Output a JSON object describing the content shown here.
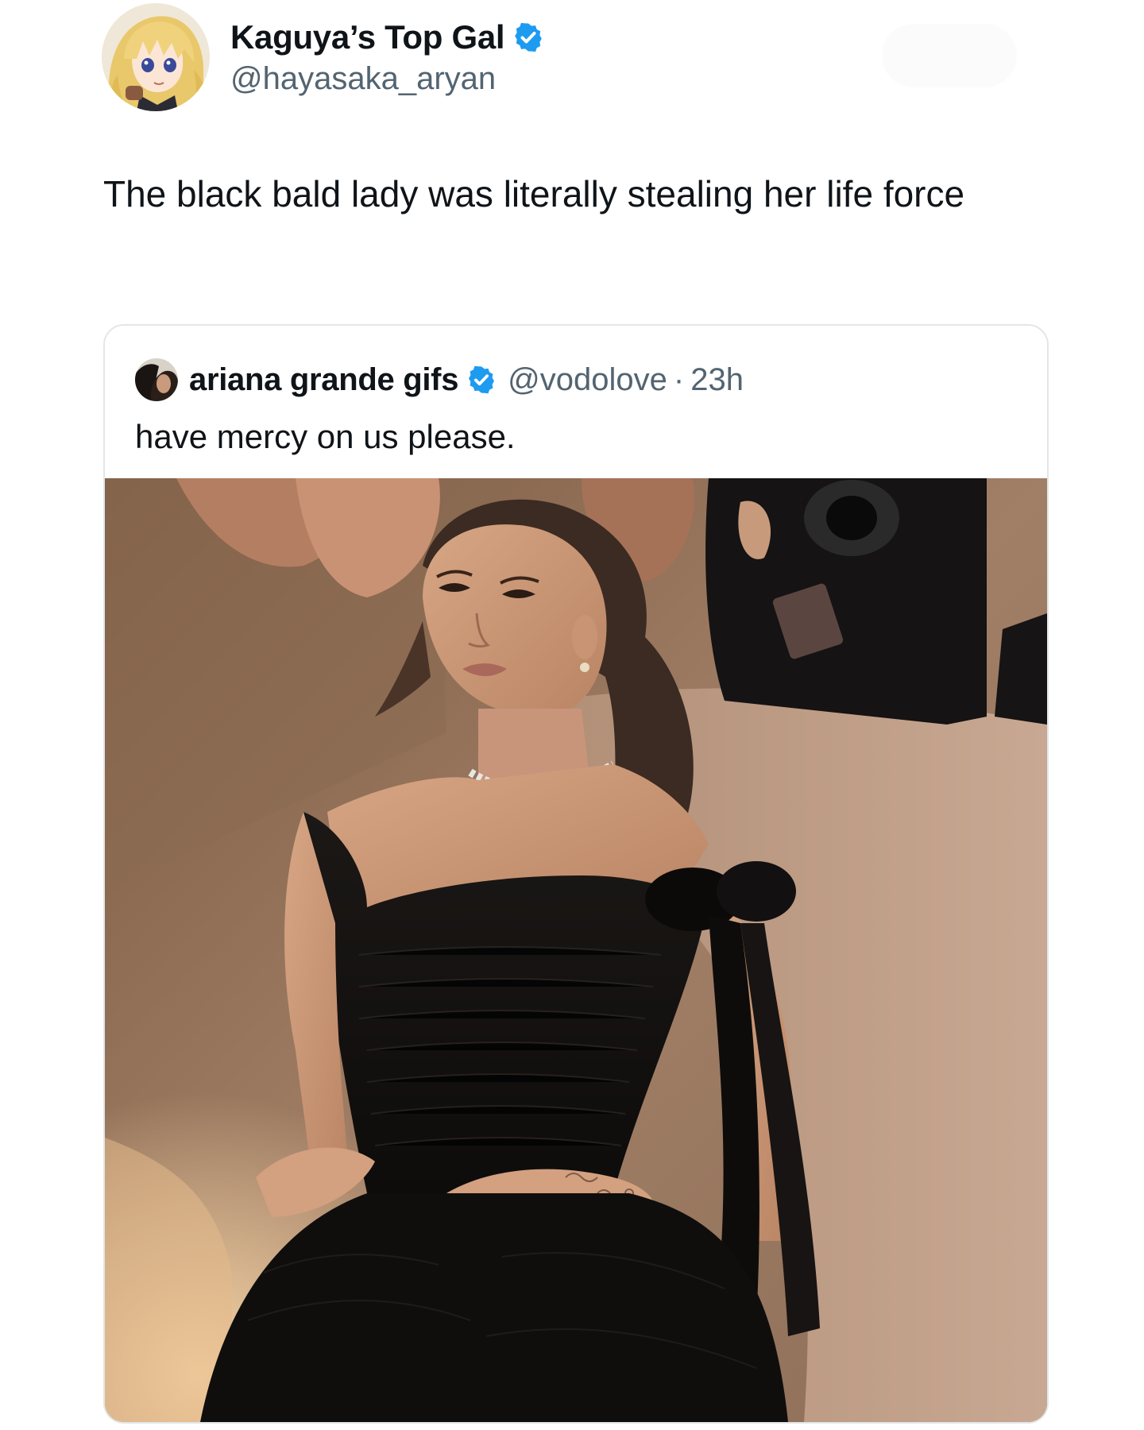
{
  "post": {
    "author": {
      "display_name": "Kaguya’s Top Gal",
      "handle": "@hayasaka_aryan",
      "verified": true
    },
    "text": "The black bald lady was literally stealing her life force"
  },
  "quoted_post": {
    "author": {
      "display_name": "ariana grande gifs",
      "handle": "@vodolove",
      "verified": true
    },
    "separator": "·",
    "time": "23h",
    "text": "have mercy on us please."
  },
  "colors": {
    "verified_badge": "#1d9bf0",
    "secondary_text": "#536471",
    "primary_text": "#0f1419",
    "card_border": "#e3e6e9"
  },
  "icons": {
    "verified": "verified-badge-icon"
  }
}
